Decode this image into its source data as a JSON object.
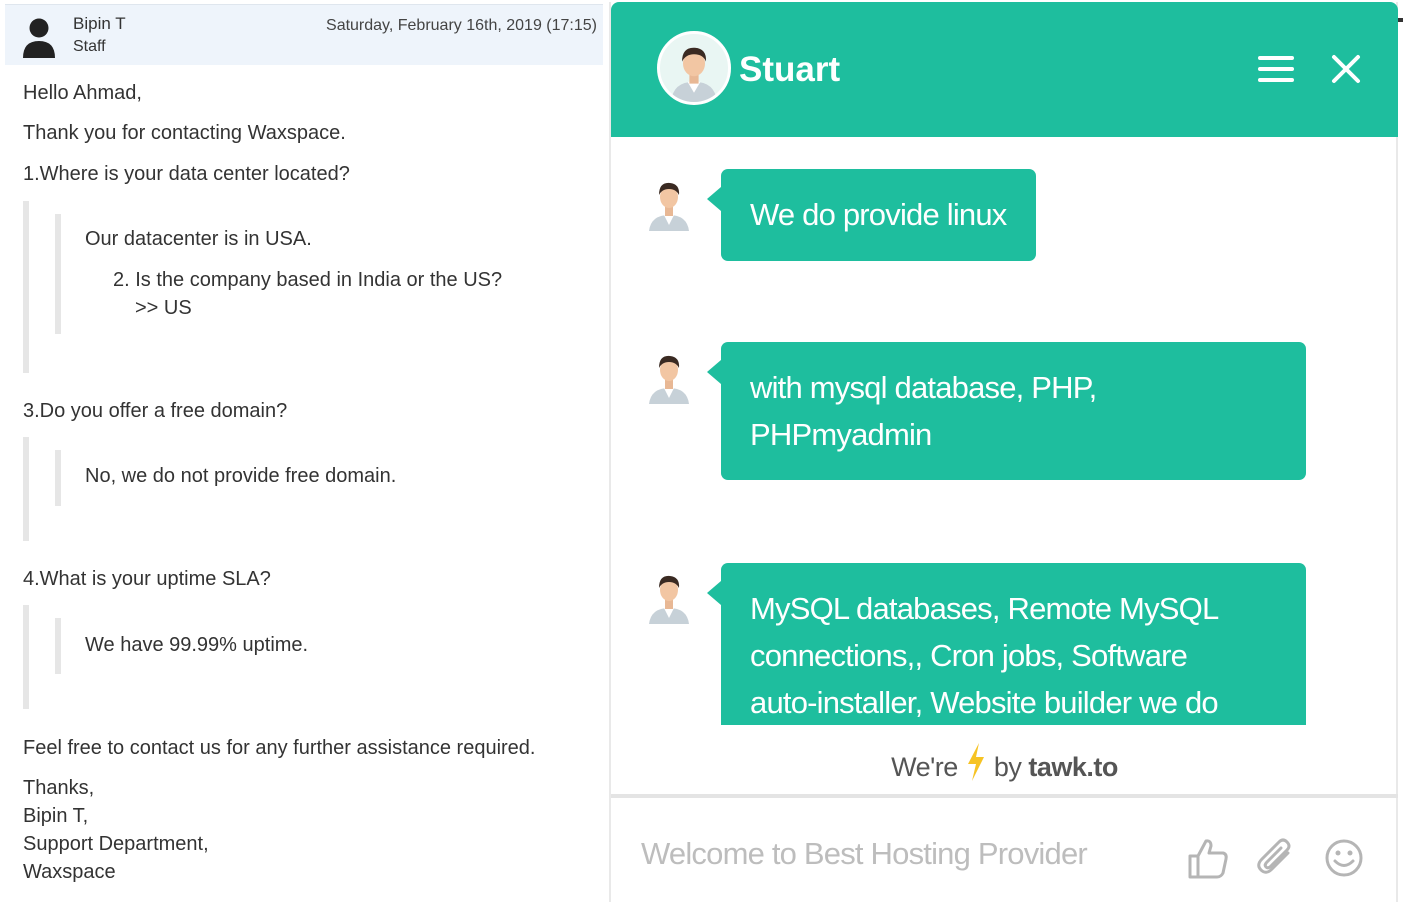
{
  "ticket": {
    "author_name": "Bipin T",
    "author_role": "Staff",
    "date": "Saturday, February 16th, 2019 (17:15)",
    "greeting": "Hello Ahmad,",
    "thanks_line": "Thank you for contacting Waxspace.",
    "q1": "1.Where is your data center located?",
    "a1": "Our datacenter is in USA.",
    "q2": "2. Is the company based in India or the US?",
    "a2": ">> US",
    "q3": "3.Do you offer a free domain?",
    "a3": "No, we do not provide free domain.",
    "q4": "4.What is your uptime SLA?",
    "a4": "We have 99.99% uptime.",
    "closing": "Feel free to contact us for any further assistance required.",
    "signature": [
      "Thanks,",
      "Bipin T,",
      "Support Department,",
      "Waxspace"
    ]
  },
  "chat": {
    "agent_name": "Stuart",
    "accent_color": "#1ebe9e",
    "messages": [
      {
        "lines": [
          "We do provide linux"
        ]
      },
      {
        "lines": [
          "with mysql database, PHP,",
          "PHPmyadmin"
        ]
      },
      {
        "lines": [
          "MySQL databases, Remote MySQL",
          "connections,, Cron jobs, Software",
          "auto-installer, Website builder we do"
        ]
      }
    ],
    "branding": {
      "prefix": "We're",
      "by": "by",
      "brand": "tawk.to"
    },
    "input_placeholder": "Welcome to Best Hosting Provider",
    "icons": {
      "menu": "menu-icon",
      "close": "close-icon",
      "like": "thumbs-up-icon",
      "attach": "paperclip-icon",
      "emoji": "smiley-icon"
    }
  }
}
